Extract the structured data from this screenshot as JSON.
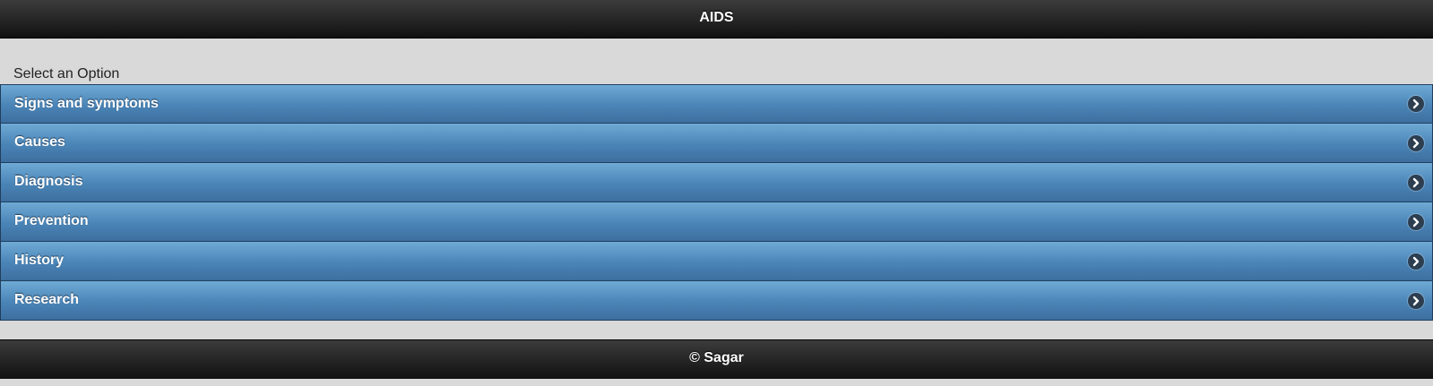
{
  "header": {
    "title": "AIDS"
  },
  "prompt": "Select an Option",
  "menu": {
    "items": [
      {
        "label": "Signs and symptoms",
        "icon": "chevron-right-icon"
      },
      {
        "label": "Causes",
        "icon": "chevron-right-icon"
      },
      {
        "label": "Diagnosis",
        "icon": "chevron-right-icon"
      },
      {
        "label": "Prevention",
        "icon": "chevron-right-icon"
      },
      {
        "label": "History",
        "icon": "chevron-right-icon"
      },
      {
        "label": "Research",
        "icon": "chevron-right-icon"
      }
    ]
  },
  "footer": {
    "text": "© Sagar"
  },
  "colors": {
    "bar": "#1a1a1a",
    "item": "#4a84b6",
    "page": "#d9d9d9"
  }
}
